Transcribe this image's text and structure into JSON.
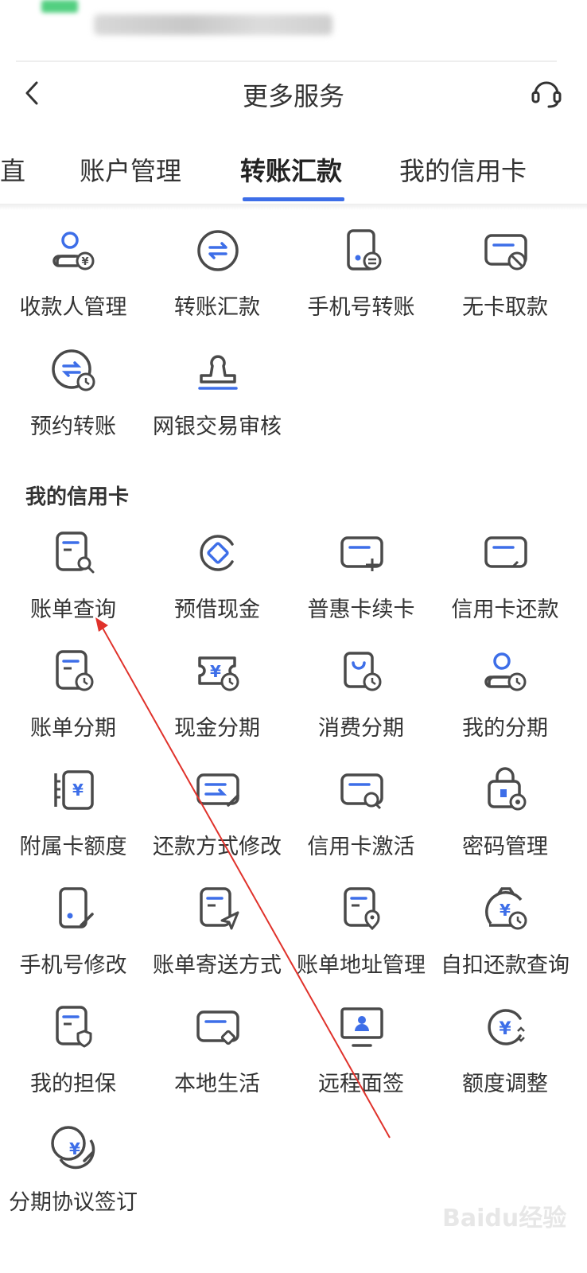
{
  "header": {
    "title": "更多服务"
  },
  "tabs": [
    {
      "label": "直"
    },
    {
      "label": "账户管理"
    },
    {
      "label": "转账汇款"
    },
    {
      "label": "我的信用卡"
    }
  ],
  "transfer_items": [
    {
      "label": "收款人管理",
      "icon": "payee-icon"
    },
    {
      "label": "转账汇款",
      "icon": "transfer-icon"
    },
    {
      "label": "手机号转账",
      "icon": "phone-transfer-icon"
    },
    {
      "label": "无卡取款",
      "icon": "cardless-withdraw-icon"
    },
    {
      "label": "预约转账",
      "icon": "scheduled-transfer-icon"
    },
    {
      "label": "网银交易审核",
      "icon": "stamp-icon"
    }
  ],
  "credit_section": {
    "title": "我的信用卡"
  },
  "credit_items": [
    {
      "label": "账单查询",
      "icon": "bill-search-icon"
    },
    {
      "label": "预借现金",
      "icon": "cash-advance-icon"
    },
    {
      "label": "普惠卡续卡",
      "icon": "card-renew-icon"
    },
    {
      "label": "信用卡还款",
      "icon": "card-repay-icon"
    },
    {
      "label": "账单分期",
      "icon": "bill-installment-icon"
    },
    {
      "label": "现金分期",
      "icon": "cash-installment-icon"
    },
    {
      "label": "消费分期",
      "icon": "purchase-installment-icon"
    },
    {
      "label": "我的分期",
      "icon": "my-installment-icon"
    },
    {
      "label": "附属卡额度",
      "icon": "supplementary-limit-icon"
    },
    {
      "label": "还款方式修改",
      "icon": "repay-method-icon"
    },
    {
      "label": "信用卡激活",
      "icon": "card-activate-icon"
    },
    {
      "label": "密码管理",
      "icon": "password-icon"
    },
    {
      "label": "手机号修改",
      "icon": "phone-edit-icon"
    },
    {
      "label": "账单寄送方式",
      "icon": "bill-delivery-icon"
    },
    {
      "label": "账单地址管理",
      "icon": "bill-address-icon"
    },
    {
      "label": "自扣还款查询",
      "icon": "auto-debit-icon"
    },
    {
      "label": "我的担保",
      "icon": "guarantee-icon"
    },
    {
      "label": "本地生活",
      "icon": "local-life-icon"
    },
    {
      "label": "远程面签",
      "icon": "remote-sign-icon"
    },
    {
      "label": "额度调整",
      "icon": "limit-adjust-icon"
    },
    {
      "label": "分期协议签订",
      "icon": "installment-agreement-icon"
    }
  ],
  "colors": {
    "icon_stroke": "#4a4a4a",
    "accent": "#3d6ee8",
    "arrow": "#e0322b"
  },
  "watermark": {
    "text": "Baidu经验"
  }
}
